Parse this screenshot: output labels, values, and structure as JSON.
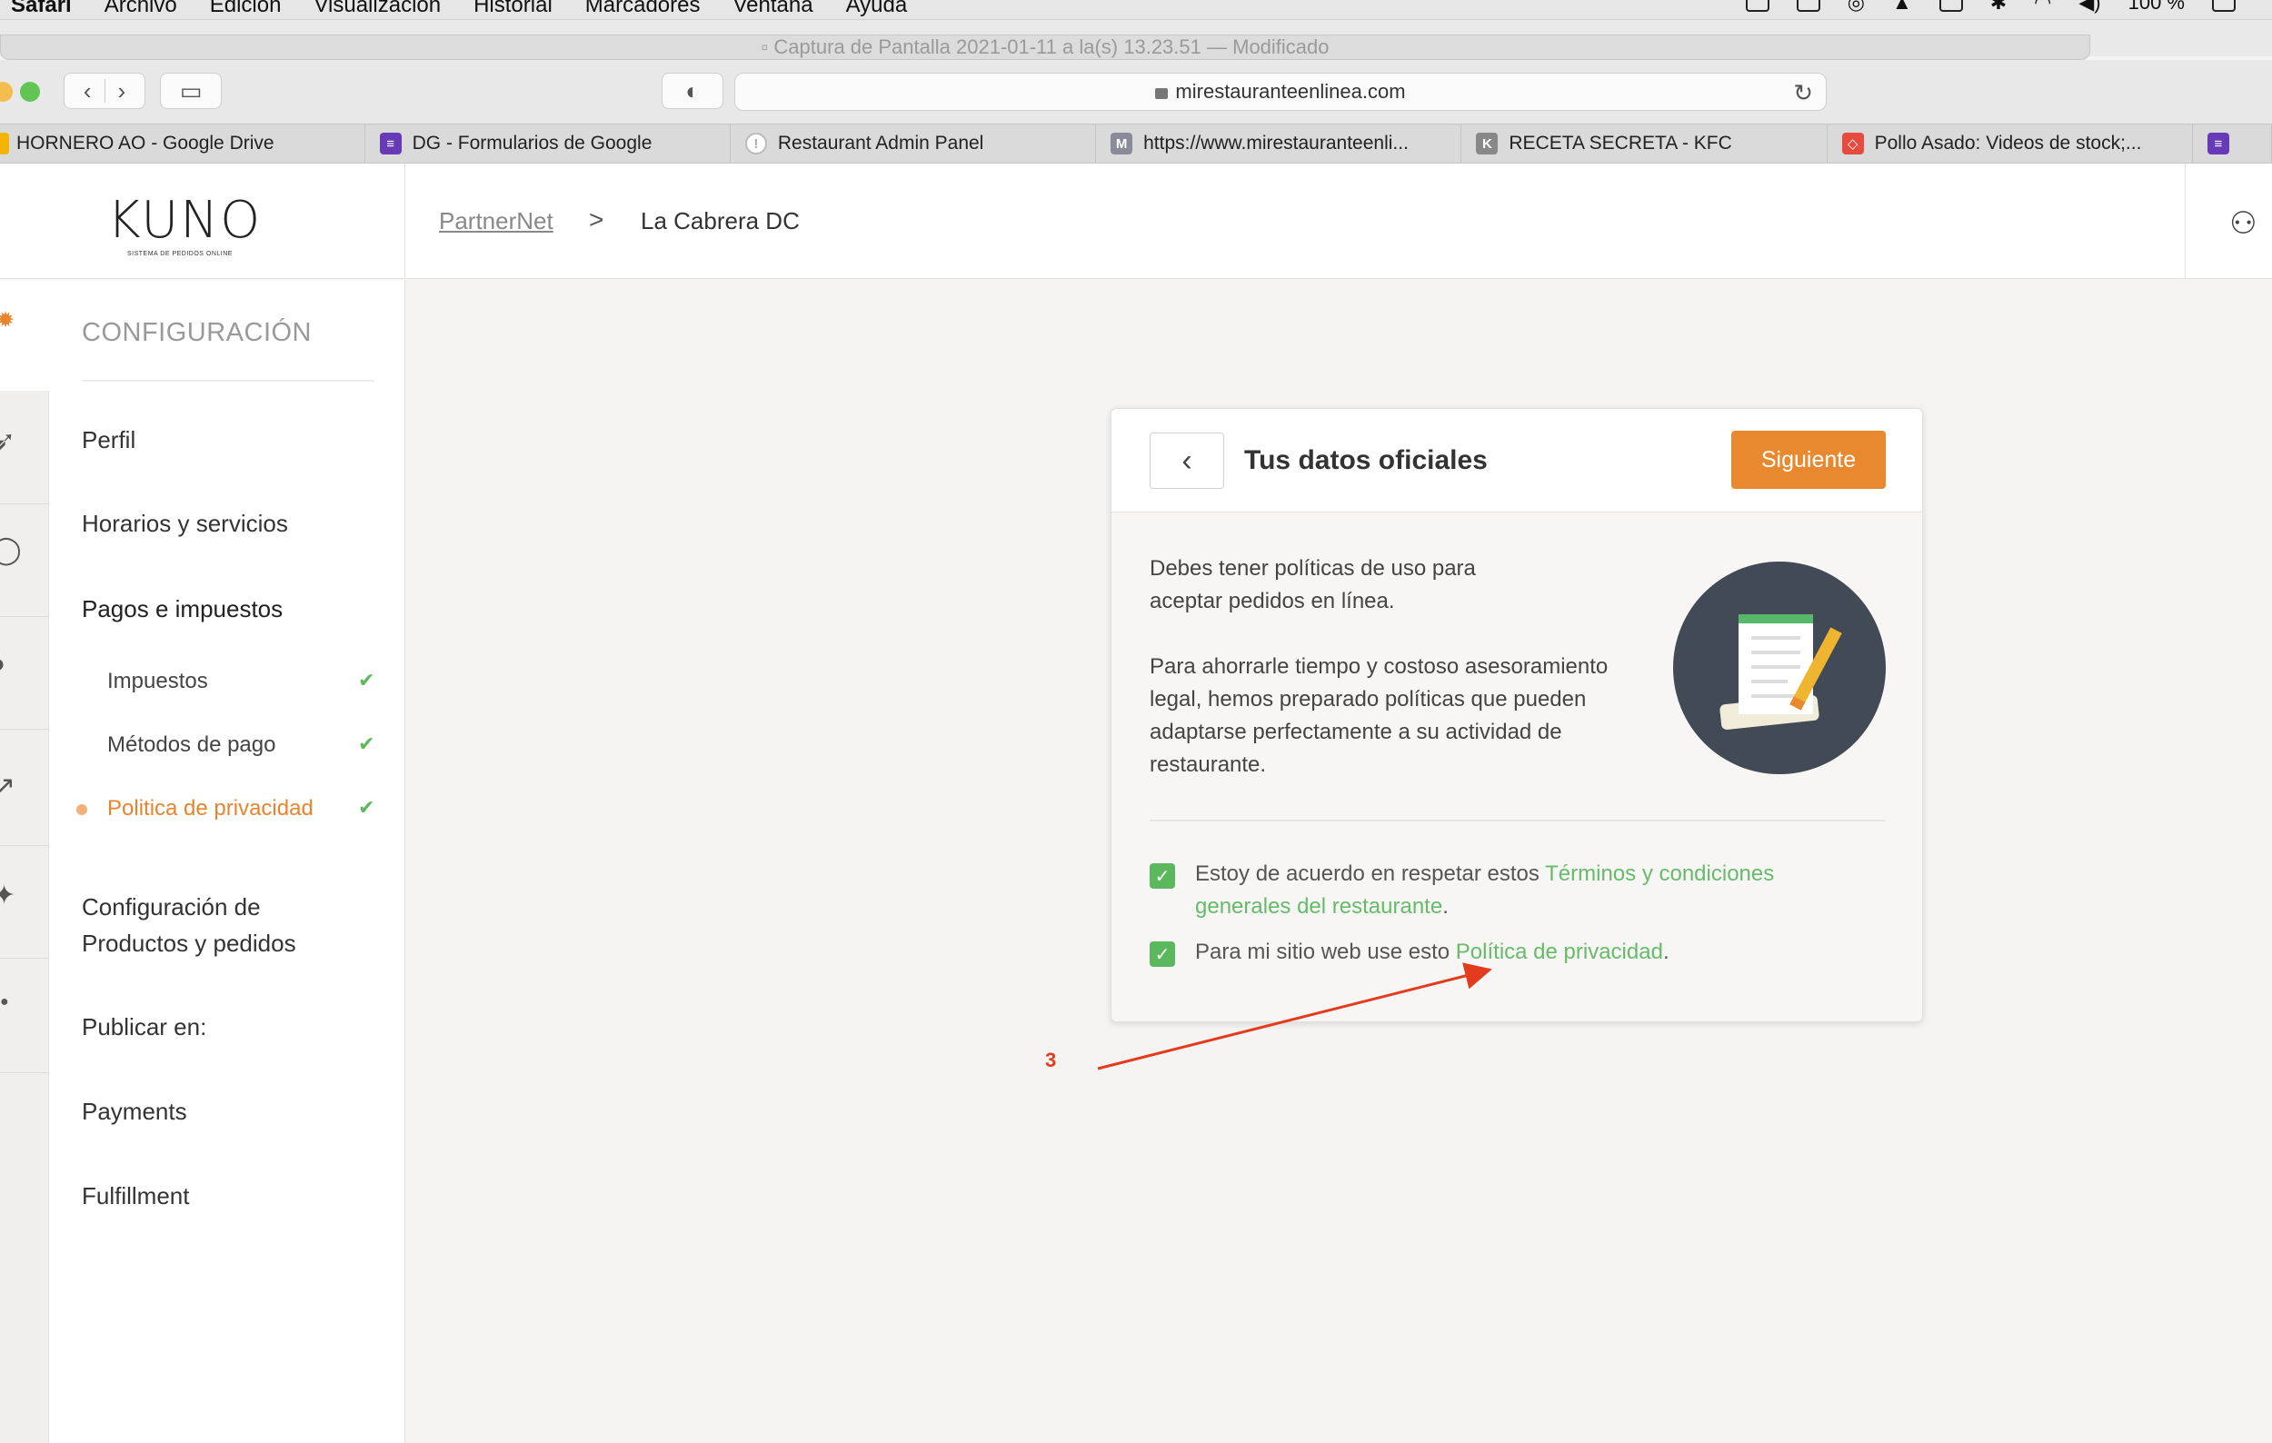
{
  "menubar": {
    "app": "Safari",
    "items": [
      "Archivo",
      "Edición",
      "Visualización",
      "Historial",
      "Marcadores",
      "Ventana",
      "Ayuda"
    ],
    "battery": "100 %"
  },
  "window": {
    "title": "Captura de Pantalla 2021-01-11 a la(s) 13.23.51",
    "title_suffix": "— Modificado"
  },
  "browser": {
    "url": "mirestauranteenlinea.com",
    "tabs": [
      {
        "label": "HORNERO AO - Google Drive",
        "fav": "",
        "color": "#f4b400"
      },
      {
        "label": "DG - Formularios de Google",
        "fav": "≡",
        "color": "#673ab7"
      },
      {
        "label": "Restaurant Admin Panel",
        "fav": "!",
        "color": "#bbbbbb"
      },
      {
        "label": "https://www.mirestauranteenli...",
        "fav": "M",
        "color": "#8a8a9a"
      },
      {
        "label": "RECETA SECRETA - KFC",
        "fav": "K",
        "color": "#888888"
      },
      {
        "label": "Pollo Asado: Videos de stock;...",
        "fav": "◇",
        "color": "#e94a3f"
      }
    ]
  },
  "header": {
    "logo": "KUNO",
    "logo_sub": "SISTEMA DE PEDIDOS ONLINE",
    "breadcrumb_root": "PartnerNet",
    "breadcrumb_sep": ">",
    "breadcrumb_current": "La Cabrera DC"
  },
  "sidebar": {
    "title": "CONFIGURACIÓN",
    "items": {
      "perfil": "Perfil",
      "horarios": "Horarios y servicios",
      "pagos": "Pagos e impuestos",
      "config_productos_1": "Configuración de",
      "config_productos_2": "Productos y pedidos",
      "publicar": "Publicar en:",
      "payments": "Payments",
      "fulfillment": "Fulfillment"
    },
    "subitems": {
      "impuestos": "Impuestos",
      "metodos": "Métodos de pago",
      "politica": "Politica de privacidad"
    }
  },
  "card": {
    "title": "Tus datos oficiales",
    "next_label": "Siguiente",
    "para1_line1": "Debes tener políticas de uso para",
    "para1_line2": "aceptar pedidos en línea.",
    "para2_line1": "Para ahorrarle tiempo y costoso asesoramiento",
    "para2_line2": "legal, hemos preparado políticas que pueden",
    "para2_line3": "adaptarse perfectamente a su actividad de",
    "para2_line4": "restaurante.",
    "check1_prefix": "Estoy de acuerdo en respetar estos ",
    "check1_link": "Términos y condiciones generales del restaurante",
    "check1_suffix": ".",
    "check2_prefix": "Para mi sitio web use esto ",
    "check2_link": "Política de privacidad",
    "check2_suffix": "."
  },
  "annotation": {
    "number": "3",
    "color": "#e23b1e"
  },
  "colors": {
    "accent": "#e8892f",
    "check_green": "#5cb85c",
    "link_green": "#66bb6a",
    "active_orange": "#e8832e"
  }
}
